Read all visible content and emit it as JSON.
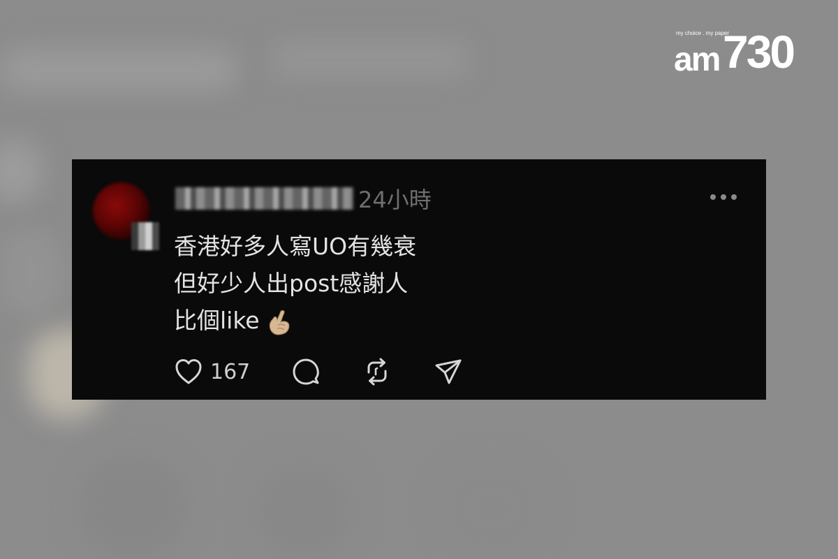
{
  "watermark": {
    "tagline": "my choice . my paper",
    "brand_prefix": "am",
    "brand_number": "730"
  },
  "post": {
    "timestamp": "24小時",
    "lines": [
      "香港好多人寫UO有幾衰",
      "但好少人出post感謝人",
      "比個like"
    ],
    "emoji": "finger-heart-emoji",
    "like_count": "167"
  },
  "actions": {
    "icons": [
      "heart-icon",
      "comment-icon",
      "repost-icon",
      "share-icon"
    ]
  },
  "colors": {
    "card_background": "#0a0a0a",
    "text": "#e3e3e3",
    "muted": "#6f6f6f",
    "page_background": "#8c8c8c",
    "watermark": "#ffffff"
  }
}
